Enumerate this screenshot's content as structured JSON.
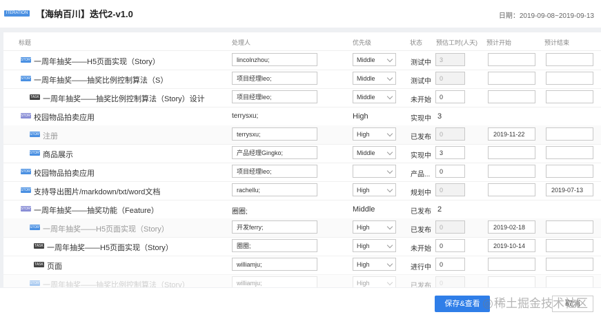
{
  "header": {
    "iteration_badge": "ITERATION",
    "title": "【海纳百川】迭代2-v1.0",
    "date_range": "日期：2019-09-08~2019-09-13"
  },
  "columns": {
    "title": "标题",
    "handler": "处理人",
    "priority": "优先级",
    "status": "状态",
    "hours": "预估工时(人天)",
    "start": "预计开始",
    "end": "预计结束"
  },
  "rows": [
    {
      "badge": "STORY",
      "title": "一周年抽奖——H5页面实现（Story）",
      "handler": "lincolnzhou;",
      "priority": "Middle",
      "status": "测试中",
      "hours": "3",
      "start": "",
      "end": ""
    },
    {
      "badge": "STORY",
      "title": "一周年抽奖——抽奖比例控制算法（S）",
      "handler": "项目经理leo;",
      "priority": "Middle",
      "status": "测试中",
      "hours": "0",
      "start": "",
      "end": ""
    },
    {
      "badge": "TASK",
      "title": "一周年抽奖——抽奖比例控制算法（Story）设计",
      "handler": "项目经理leo;",
      "priority": "Middle",
      "status": "未开始",
      "hours": "0",
      "start": "",
      "end": ""
    },
    {
      "badge": "STORY",
      "title": "校园物品拍卖应用",
      "handler": "terrysxu;",
      "priority": "High",
      "status": "实现中",
      "hours": "3",
      "start": "",
      "end": ""
    },
    {
      "badge": "STORY",
      "title": "注册",
      "handler": "terrysxu;",
      "priority": "High",
      "status": "已发布",
      "hours": "0",
      "start": "2019-11-22",
      "end": ""
    },
    {
      "badge": "STORY",
      "title": "商品展示",
      "handler": "产品经理Gingko;",
      "priority": "Middle",
      "status": "实现中",
      "hours": "3",
      "start": "",
      "end": ""
    },
    {
      "badge": "STORY",
      "title": "校园物品拍卖应用",
      "handler": "项目经理leo;",
      "priority": "",
      "status": "产品...",
      "hours": "0",
      "start": "",
      "end": ""
    },
    {
      "badge": "STORY",
      "title": "支持导出图片/markdown/txt/word文档",
      "handler": "rachellu;",
      "priority": "High",
      "status": "规划中",
      "hours": "0",
      "start": "",
      "end": "2019-07-13"
    },
    {
      "badge": "STORY",
      "title": "一周年抽奖——抽奖功能（Feature）",
      "handler": "圈圈;",
      "priority": "Middle",
      "status": "已发布",
      "hours": "2",
      "start": "",
      "end": ""
    },
    {
      "badge": "STORY",
      "title": "一周年抽奖——H5页面实现（Story）",
      "handler": "开发ferry;",
      "priority": "High",
      "status": "已发布",
      "hours": "0",
      "start": "2019-02-18",
      "end": ""
    },
    {
      "badge": "TASK",
      "title": "一周年抽奖——H5页面实现（Story）",
      "handler": "圈圈;",
      "priority": "High",
      "status": "未开始",
      "hours": "0",
      "start": "2019-10-14",
      "end": ""
    },
    {
      "badge": "TASK",
      "title": "页面",
      "handler": "williamju;",
      "priority": "High",
      "status": "进行中",
      "hours": "0",
      "start": "",
      "end": ""
    },
    {
      "badge": "STORY",
      "title": "一周年抽奖——抽奖比例控制算法（Story）",
      "handler": "williamju;",
      "priority": "High",
      "status": "已发布",
      "hours": "0",
      "start": "",
      "end": ""
    }
  ],
  "footer": {
    "save_label": "保存&查看",
    "cancel_label": "取消",
    "watermark": "稀土掘金技术社区",
    "watermark_icon": "@"
  }
}
